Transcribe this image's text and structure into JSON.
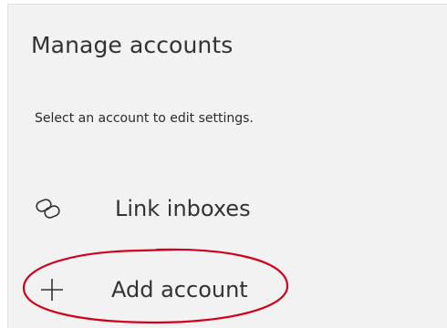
{
  "panel": {
    "title": "Manage accounts",
    "subtitle": "Select an account to edit settings."
  },
  "menu": {
    "items": [
      {
        "icon": "link-icon",
        "label": "Link inboxes"
      },
      {
        "icon": "plus-icon",
        "label": "Add account"
      }
    ]
  },
  "colors": {
    "panel_background": "#f2f2f2",
    "text": "#333333",
    "highlight": "#d0021b"
  }
}
